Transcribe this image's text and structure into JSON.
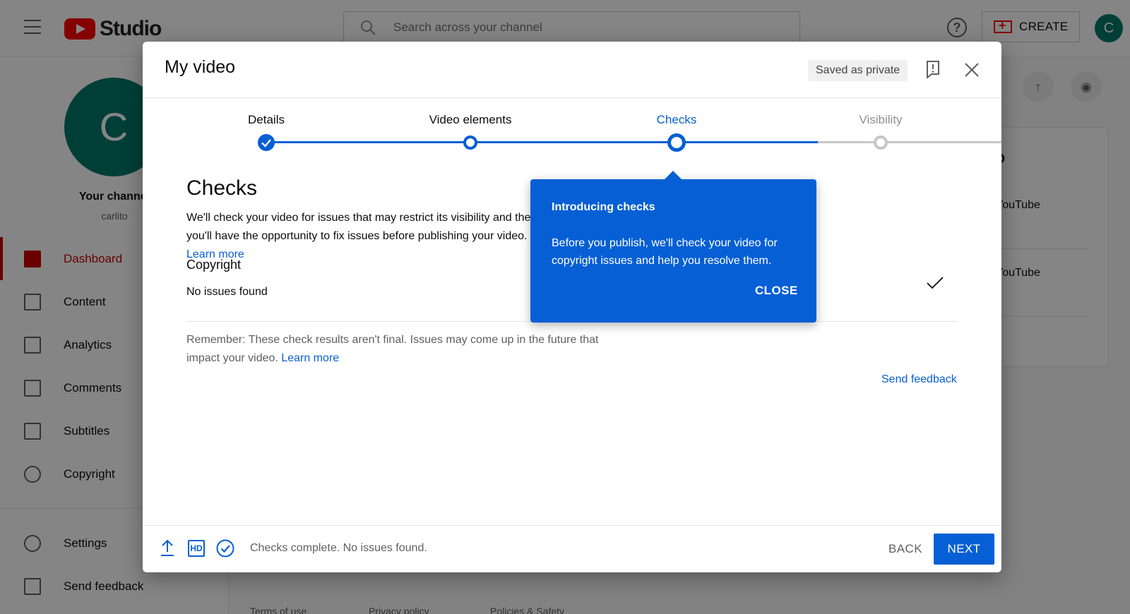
{
  "app": {
    "logo_text": "Studio",
    "search": {
      "placeholder": "Search across your channel"
    },
    "create_label": "CREATE",
    "avatar_letter": "C"
  },
  "sidebar": {
    "avatar_letter": "C",
    "channel_label": "Your channel",
    "handle": "carlito",
    "items": [
      {
        "label": "Dashboard",
        "icon": "dashboard-icon",
        "active": true
      },
      {
        "label": "Content",
        "icon": "content-icon"
      },
      {
        "label": "Analytics",
        "icon": "analytics-icon"
      },
      {
        "label": "Comments",
        "icon": "comments-icon"
      },
      {
        "label": "Subtitles",
        "icon": "subtitles-icon"
      },
      {
        "label": "Copyright",
        "icon": "copyright-icon"
      }
    ],
    "bottom_items": [
      {
        "label": "Settings",
        "icon": "gear-icon"
      },
      {
        "label": "Send feedback",
        "icon": "feedback-icon"
      }
    ]
  },
  "background_panel": {
    "title": "D",
    "line1": "YouTube",
    "line2": "YouTube"
  },
  "footer_links": [
    "Terms of use",
    "Privacy policy",
    "Policies & Safety"
  ],
  "dialog": {
    "title": "My video",
    "saved_label": "Saved as private",
    "steps": [
      {
        "label": "Details",
        "state": "done"
      },
      {
        "label": "Video elements",
        "state": "done"
      },
      {
        "label": "Checks",
        "state": "current"
      },
      {
        "label": "Visibility",
        "state": "todo"
      }
    ],
    "section_title": "Checks",
    "section_desc": "We'll check your video for issues that may restrict its visibility and then you'll have the opportunity to fix issues before publishing your video.",
    "learn_more": "Learn more",
    "copyright_title": "Copyright",
    "copyright_status": "No issues found",
    "remember_text": "Remember: These check results aren't final. Issues may come up in the future that impact your video.",
    "remember_link": "Learn more",
    "send_feedback": "Send feedback",
    "footer_status": "Checks complete. No issues found.",
    "hd_badge": "HD",
    "back_label": "BACK",
    "next_label": "NEXT"
  },
  "tooltip": {
    "title": "Introducing checks",
    "body": "Before you publish, we'll check your video for copyright issues and help you resolve them.",
    "close_label": "CLOSE"
  },
  "colors": {
    "accent": "#065fd4",
    "brand_red": "#ff0000",
    "active_red": "#cc0000",
    "avatar_teal": "#00796b"
  }
}
